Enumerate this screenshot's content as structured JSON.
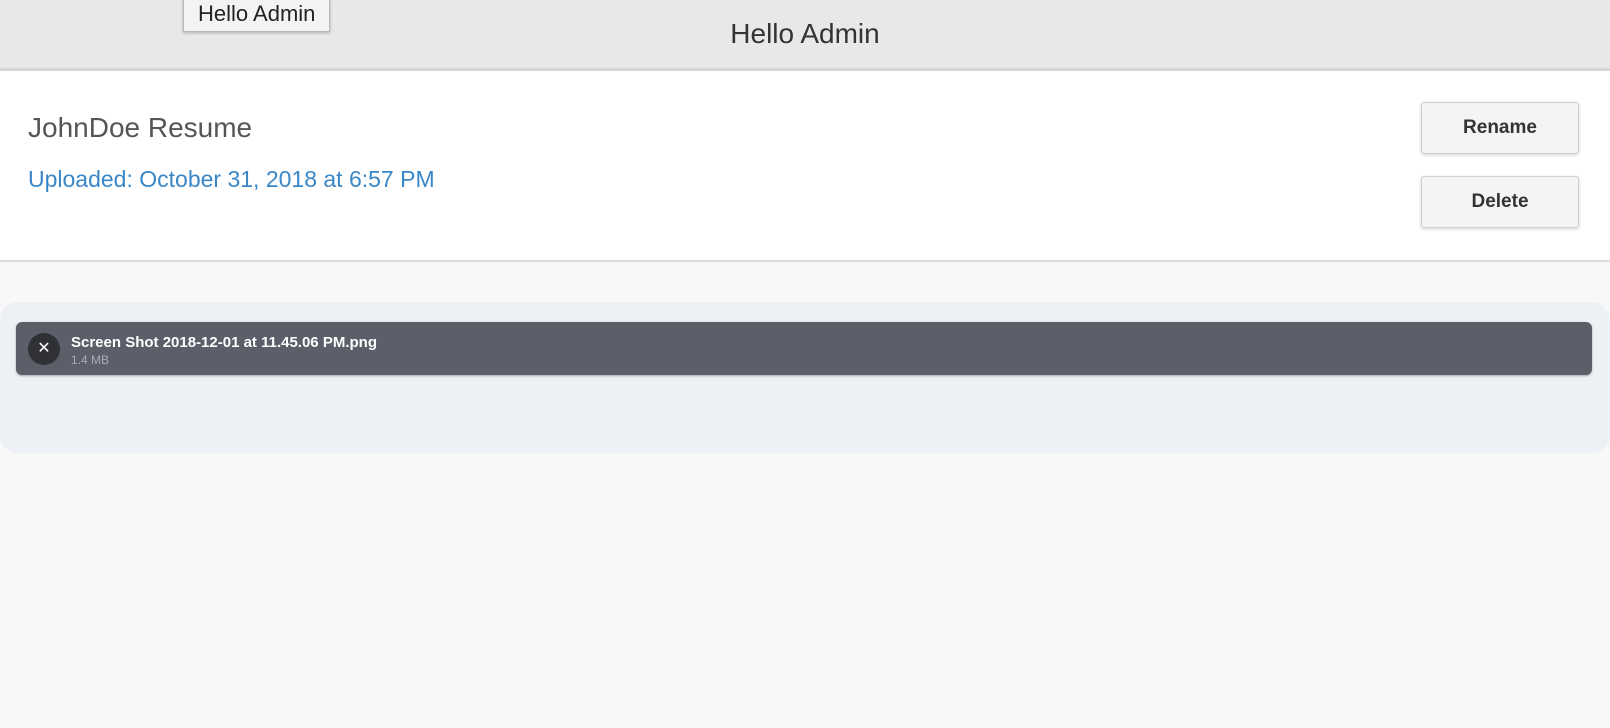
{
  "header": {
    "title": "Hello Admin",
    "tooltip": "Hello Admin"
  },
  "document": {
    "title": "JohnDoe Resume",
    "uploaded": "Uploaded: October 31, 2018 at 6:57 PM",
    "rename_label": "Rename",
    "delete_label": "Delete"
  },
  "dropzone": {
    "files": [
      {
        "name": "Screen Shot 2018-12-01 at 11.45.06 PM.png",
        "size": "1.4 MB",
        "remove_icon": "close-icon"
      }
    ]
  },
  "colors": {
    "accent_link": "#3a87c8",
    "file_item_bg": "#5b5f69",
    "dropzone_bg": "#edf0f4",
    "header_bg": "#e8e8e8"
  }
}
